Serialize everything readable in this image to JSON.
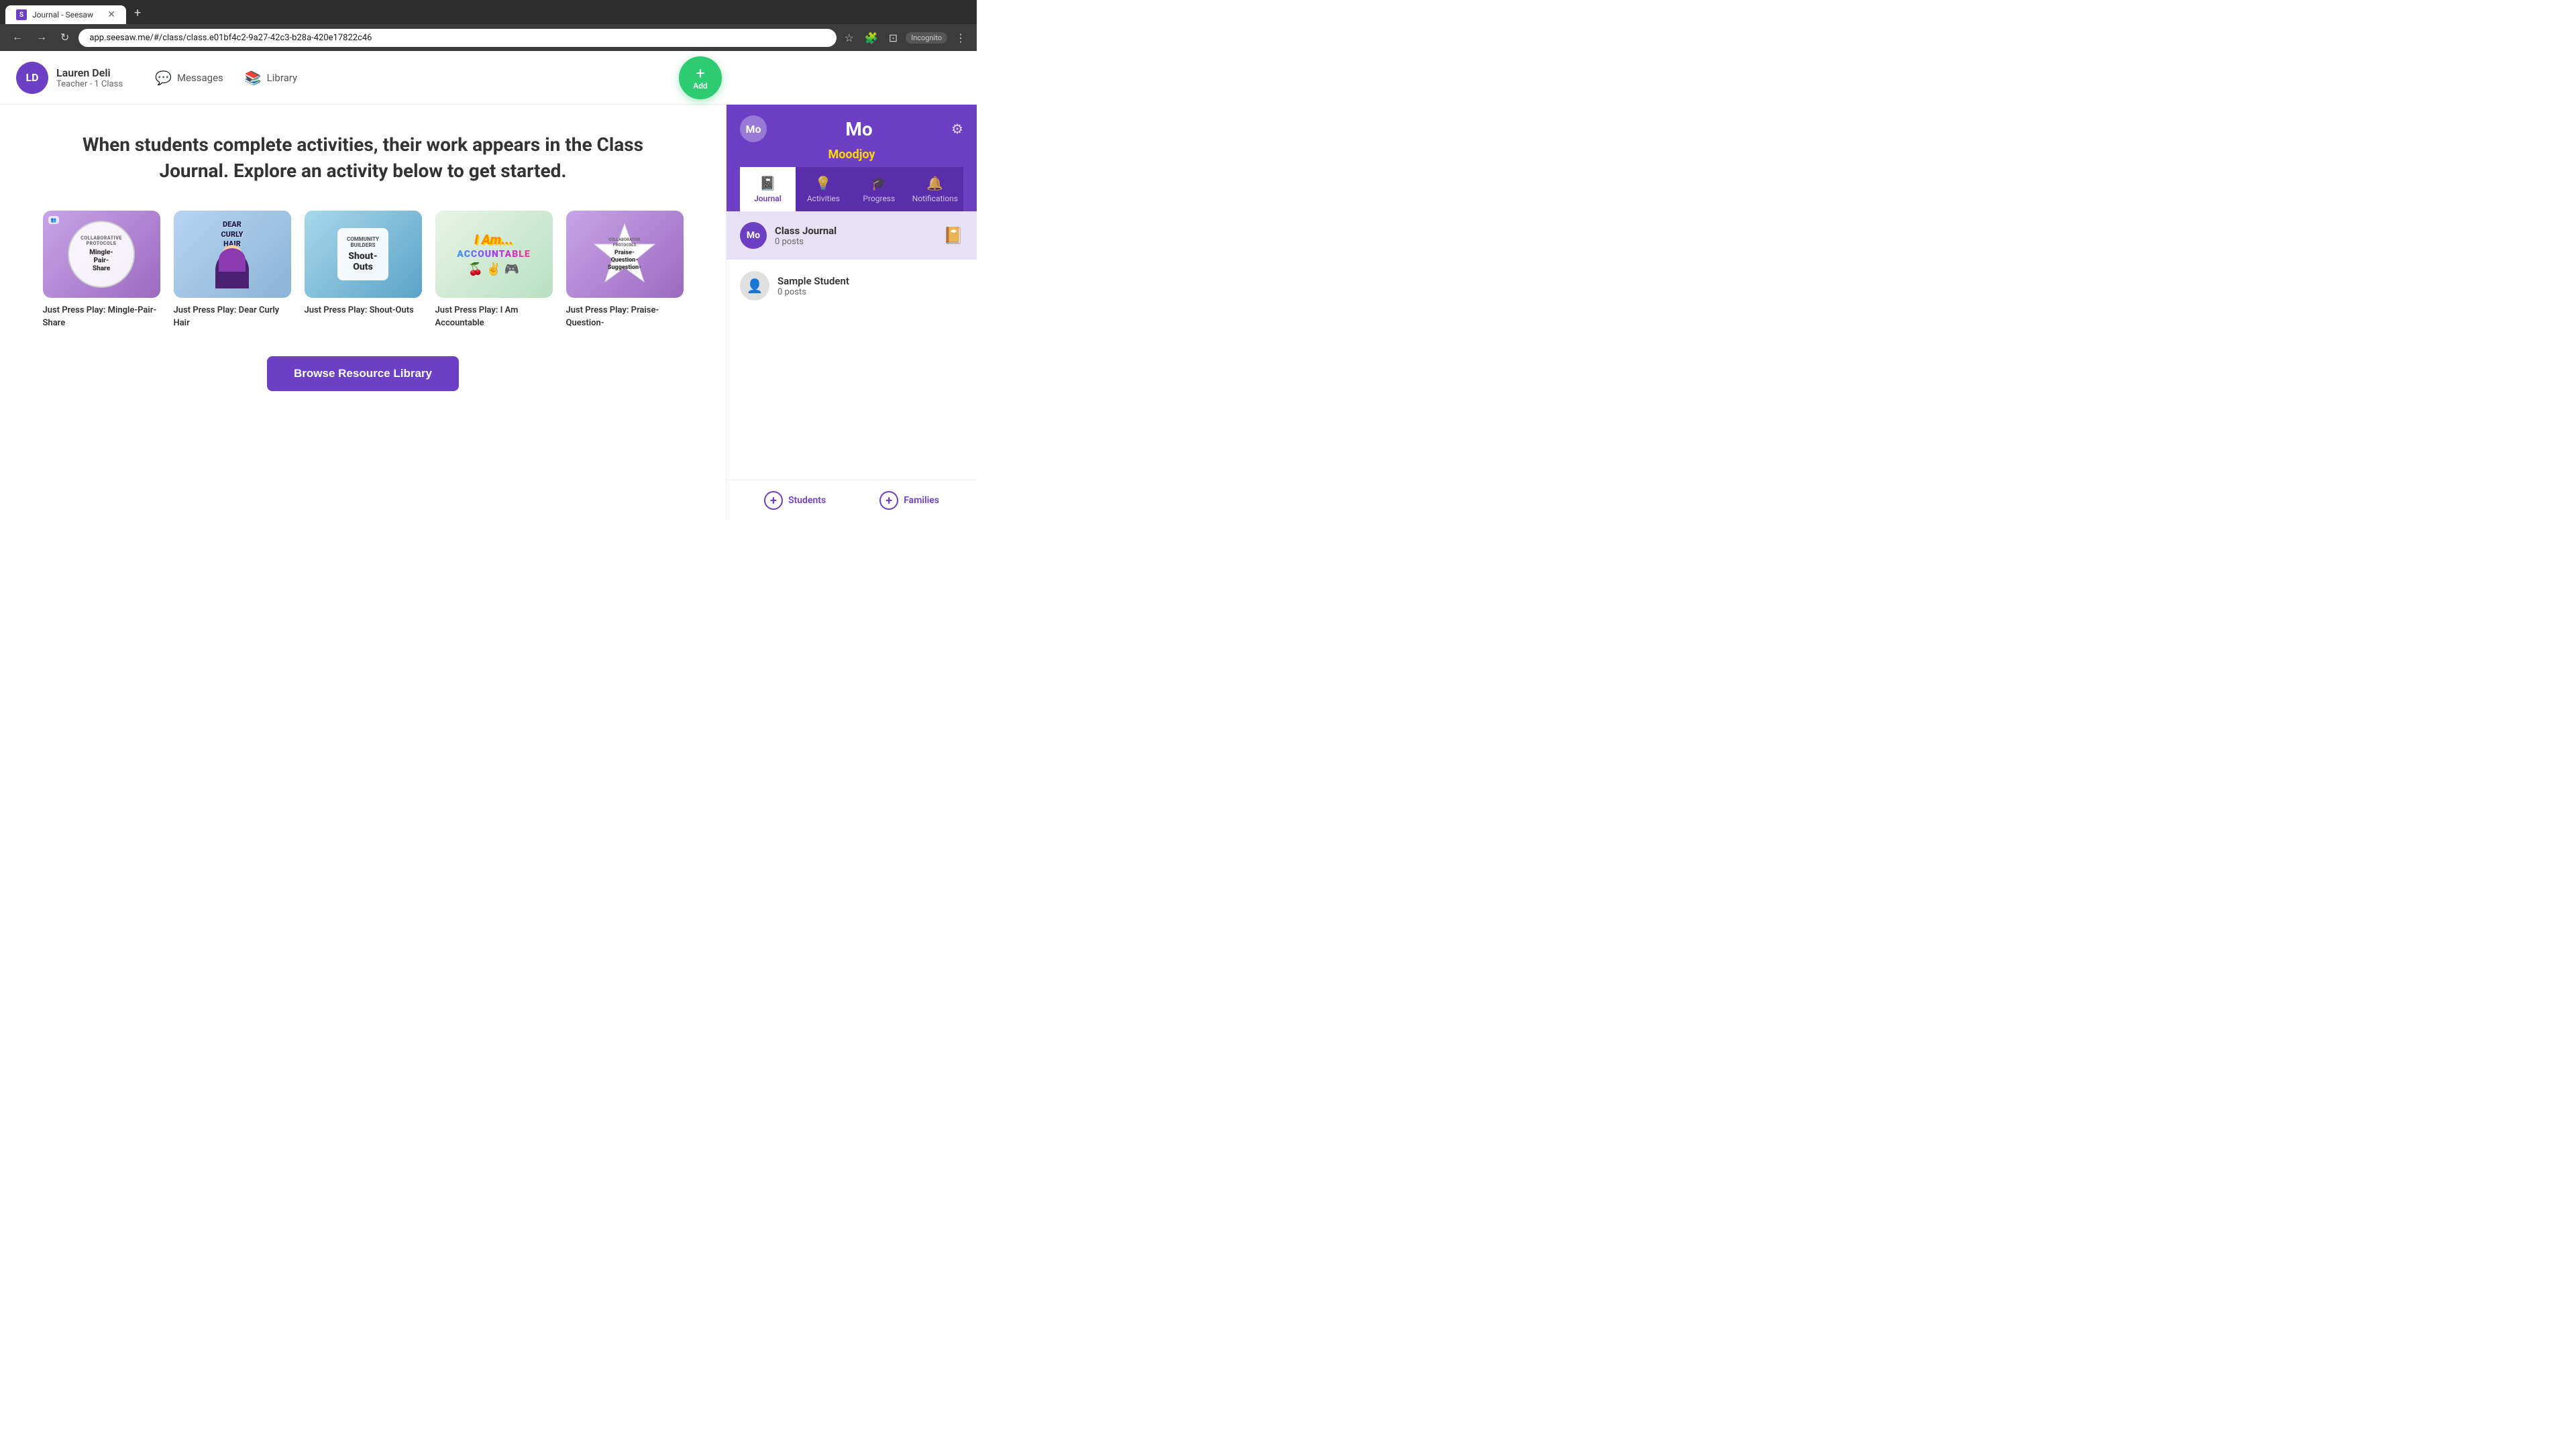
{
  "browser": {
    "tab_title": "Journal - Seesaw",
    "tab_favicon": "S",
    "address_url": "app.seesaw.me/#/class/class.e01bf4c2-9a27-42c3-b28a-420e17822c46",
    "incognito_label": "Incognito",
    "new_tab_label": "+"
  },
  "header": {
    "user_initials": "LD",
    "user_name": "Lauren Deli",
    "user_role": "Teacher - 1 Class",
    "nav_messages": "Messages",
    "nav_library": "Library",
    "add_label": "Add"
  },
  "main": {
    "hero_text": "When students complete activities, their work appears in the Class Journal. Explore an activity below to get started.",
    "browse_button_label": "Browse Resource Library",
    "activities": [
      {
        "title": "Just Press Play: Mingle-Pair-Share",
        "thumb_text": "Mingle-Pair-Share",
        "thumb_sub": "COLLABORATIVE PROTOCOLS",
        "color": "purple"
      },
      {
        "title": "Just Press Play: Dear Curly Hair",
        "thumb_text": "DEAR CURLY HAIR",
        "thumb_sub": "",
        "color": "blue"
      },
      {
        "title": "Just Press Play: Shout-Outs",
        "thumb_text": "COMMUNITY BUILDERS Shout-Outs",
        "thumb_sub": "",
        "color": "teal"
      },
      {
        "title": "Just Press Play: I Am Accountable",
        "thumb_text": "I Am... ACCOUNTABLE",
        "thumb_sub": "",
        "color": "green"
      },
      {
        "title": "Just Press Play: Praise-Question-",
        "thumb_text": "Praise-Question-Suggestion",
        "thumb_sub": "COLLABORATIVE PROTOCOLS",
        "color": "purple"
      }
    ]
  },
  "sidebar": {
    "class_initial": "Mo",
    "class_name_short": "Mo",
    "moodjoy_label": "Moodjoy",
    "tabs": [
      {
        "label": "Journal",
        "icon": "📓",
        "active": true
      },
      {
        "label": "Activities",
        "icon": "💡",
        "active": false
      },
      {
        "label": "Progress",
        "icon": "🎓",
        "active": false
      },
      {
        "label": "Notifications",
        "icon": "🔔",
        "active": false
      }
    ],
    "class_journal": {
      "title": "Class Journal",
      "posts": "0 posts",
      "initial": "Mo"
    },
    "sample_student": {
      "name": "Sample Student",
      "posts": "0 posts"
    },
    "footer": {
      "students_label": "Students",
      "families_label": "Families"
    }
  }
}
